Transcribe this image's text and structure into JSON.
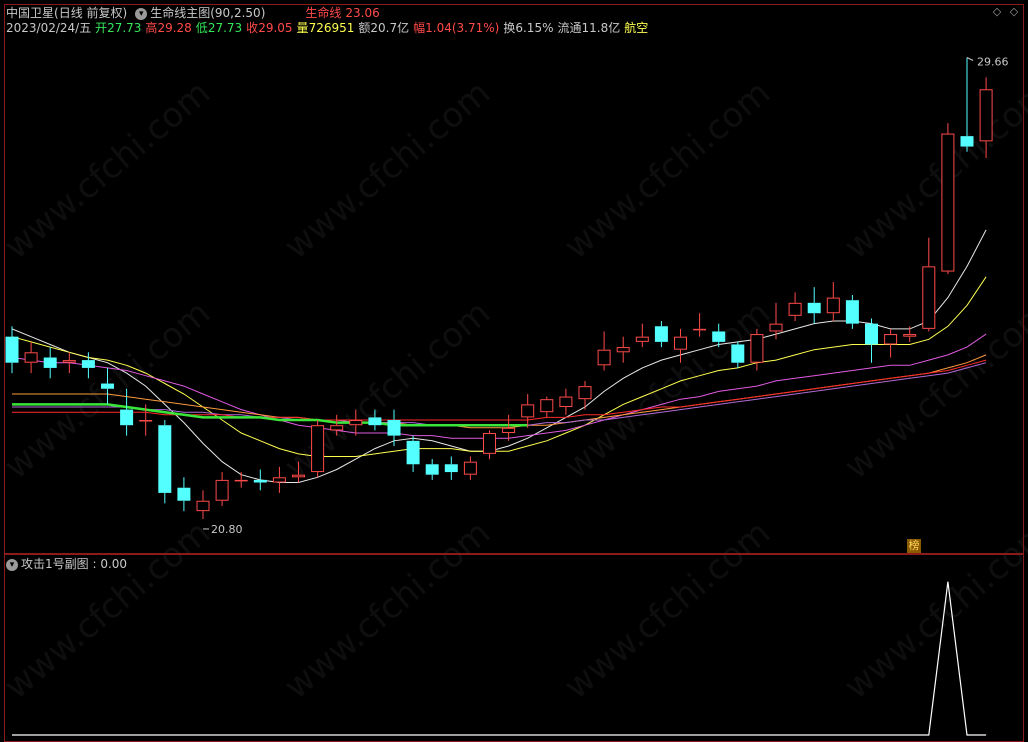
{
  "header": {
    "stock_name": "中国卫星",
    "period_mode": "(日线 前复权)",
    "indicator_name": "生命线主图(90,2.50)",
    "lifeline_label": "生命线",
    "lifeline_value": "23.06"
  },
  "quote": {
    "date": "2023/02/24/五",
    "open_label": "开",
    "open": "27.73",
    "high_label": "高",
    "high": "29.28",
    "low_label": "低",
    "low": "27.73",
    "close_label": "收",
    "close": "29.05",
    "volume_label": "量",
    "volume": "726951",
    "amount_label": "额",
    "amount": "20.7亿",
    "change_label": "幅",
    "change": "1.04(3.71%)",
    "turnover_label": "换",
    "turnover": "6.15%",
    "float_label": "流通",
    "float": "11.8亿",
    "sector": "航空"
  },
  "sub_chart": {
    "title": "攻击1号副图",
    "value": "0.00"
  },
  "badge": "榜",
  "watermark": "www.cfchi.com",
  "colors": {
    "up": "#ff4a4a",
    "down": "#54ffff",
    "lifeline": "#39e639",
    "frame": "#8b1a1a"
  },
  "chart_data": {
    "type": "candlestick",
    "high_label": "29.66",
    "low_label": "20.80",
    "candles": [
      {
        "o": 24.3,
        "c": 23.8,
        "h": 24.5,
        "l": 23.6
      },
      {
        "o": 23.8,
        "c": 24.0,
        "h": 24.2,
        "l": 23.6
      },
      {
        "o": 23.9,
        "c": 23.7,
        "h": 24.1,
        "l": 23.5
      },
      {
        "o": 23.8,
        "c": 23.85,
        "h": 24.0,
        "l": 23.6
      },
      {
        "o": 23.85,
        "c": 23.7,
        "h": 24.0,
        "l": 23.5
      },
      {
        "o": 23.4,
        "c": 23.3,
        "h": 23.7,
        "l": 23.0
      },
      {
        "o": 22.9,
        "c": 22.6,
        "h": 23.3,
        "l": 22.4
      },
      {
        "o": 22.7,
        "c": 22.7,
        "h": 23.0,
        "l": 22.4
      },
      {
        "o": 22.6,
        "c": 21.3,
        "h": 22.7,
        "l": 21.1
      },
      {
        "o": 21.4,
        "c": 21.15,
        "h": 21.6,
        "l": 20.95
      },
      {
        "o": 20.95,
        "c": 21.15,
        "h": 21.35,
        "l": 20.8
      },
      {
        "o": 21.15,
        "c": 21.55,
        "h": 21.7,
        "l": 21.05
      },
      {
        "o": 21.55,
        "c": 21.55,
        "h": 21.7,
        "l": 21.4
      },
      {
        "o": 21.55,
        "c": 21.5,
        "h": 21.75,
        "l": 21.35
      },
      {
        "o": 21.5,
        "c": 21.6,
        "h": 21.8,
        "l": 21.3
      },
      {
        "o": 21.6,
        "c": 21.65,
        "h": 21.9,
        "l": 21.5
      },
      {
        "o": 21.7,
        "c": 22.6,
        "h": 22.7,
        "l": 21.6
      },
      {
        "o": 22.5,
        "c": 22.6,
        "h": 22.8,
        "l": 22.4
      },
      {
        "o": 22.6,
        "c": 22.7,
        "h": 22.9,
        "l": 22.4
      },
      {
        "o": 22.75,
        "c": 22.6,
        "h": 22.9,
        "l": 22.5
      },
      {
        "o": 22.7,
        "c": 22.4,
        "h": 22.9,
        "l": 22.2
      },
      {
        "o": 22.3,
        "c": 21.85,
        "h": 22.4,
        "l": 21.7
      },
      {
        "o": 21.85,
        "c": 21.65,
        "h": 21.95,
        "l": 21.55
      },
      {
        "o": 21.85,
        "c": 21.7,
        "h": 22.0,
        "l": 21.55
      },
      {
        "o": 21.65,
        "c": 21.9,
        "h": 22.0,
        "l": 21.55
      },
      {
        "o": 22.05,
        "c": 22.45,
        "h": 22.5,
        "l": 21.95
      },
      {
        "o": 22.45,
        "c": 22.55,
        "h": 22.8,
        "l": 22.3
      },
      {
        "o": 22.75,
        "c": 23.0,
        "h": 23.2,
        "l": 22.55
      },
      {
        "o": 22.85,
        "c": 23.1,
        "h": 23.15,
        "l": 22.75
      },
      {
        "o": 22.95,
        "c": 23.15,
        "h": 23.3,
        "l": 22.8
      },
      {
        "o": 23.1,
        "c": 23.35,
        "h": 23.45,
        "l": 22.9
      },
      {
        "o": 23.75,
        "c": 24.05,
        "h": 24.4,
        "l": 23.65
      },
      {
        "o": 24.0,
        "c": 24.1,
        "h": 24.3,
        "l": 23.8
      },
      {
        "o": 24.2,
        "c": 24.3,
        "h": 24.55,
        "l": 24.1
      },
      {
        "o": 24.5,
        "c": 24.2,
        "h": 24.6,
        "l": 24.1
      },
      {
        "o": 24.05,
        "c": 24.3,
        "h": 24.45,
        "l": 23.8
      },
      {
        "o": 24.45,
        "c": 24.45,
        "h": 24.75,
        "l": 24.3
      },
      {
        "o": 24.4,
        "c": 24.2,
        "h": 24.55,
        "l": 24.1
      },
      {
        "o": 24.15,
        "c": 23.8,
        "h": 24.2,
        "l": 23.7
      },
      {
        "o": 23.8,
        "c": 24.35,
        "h": 24.45,
        "l": 23.65
      },
      {
        "o": 24.4,
        "c": 24.55,
        "h": 24.95,
        "l": 24.25
      },
      {
        "o": 24.7,
        "c": 24.95,
        "h": 25.15,
        "l": 24.6
      },
      {
        "o": 24.95,
        "c": 24.75,
        "h": 25.25,
        "l": 24.55
      },
      {
        "o": 24.75,
        "c": 25.05,
        "h": 25.35,
        "l": 24.6
      },
      {
        "o": 25.0,
        "c": 24.55,
        "h": 25.1,
        "l": 24.45
      },
      {
        "o": 24.55,
        "c": 24.15,
        "h": 24.65,
        "l": 23.8
      },
      {
        "o": 24.15,
        "c": 24.35,
        "h": 24.45,
        "l": 23.9
      },
      {
        "o": 24.3,
        "c": 24.35,
        "h": 24.5,
        "l": 24.2
      },
      {
        "o": 24.45,
        "c": 25.65,
        "h": 26.2,
        "l": 24.4
      },
      {
        "o": 25.55,
        "c": 28.2,
        "h": 28.4,
        "l": 25.5
      },
      {
        "o": 28.15,
        "c": 27.95,
        "h": 29.66,
        "l": 27.85
      },
      {
        "o": 28.05,
        "c": 29.05,
        "h": 29.28,
        "l": 27.73
      }
    ],
    "mas": [
      {
        "name": "ma-white",
        "color": "#e8e8e8",
        "values": [
          24.45,
          24.3,
          24.15,
          24.0,
          23.9,
          23.8,
          23.6,
          23.35,
          23.0,
          22.65,
          22.25,
          21.9,
          21.65,
          21.55,
          21.5,
          21.5,
          21.6,
          21.75,
          21.95,
          22.15,
          22.3,
          22.35,
          22.3,
          22.2,
          22.1,
          22.1,
          22.2,
          22.35,
          22.55,
          22.75,
          22.95,
          23.25,
          23.5,
          23.7,
          23.85,
          23.95,
          24.05,
          24.15,
          24.2,
          24.25,
          24.35,
          24.45,
          24.55,
          24.6,
          24.6,
          24.55,
          24.45,
          24.45,
          24.6,
          25.05,
          25.65,
          26.35
        ]
      },
      {
        "name": "ma-yellow",
        "color": "#ffff50",
        "values": [
          24.3,
          24.2,
          24.1,
          24.0,
          23.9,
          23.85,
          23.75,
          23.6,
          23.4,
          23.2,
          22.95,
          22.7,
          22.45,
          22.3,
          22.15,
          22.05,
          22.0,
          22.0,
          22.0,
          22.05,
          22.1,
          22.15,
          22.15,
          22.15,
          22.1,
          22.1,
          22.1,
          22.2,
          22.3,
          22.45,
          22.6,
          22.8,
          23.0,
          23.15,
          23.3,
          23.45,
          23.55,
          23.65,
          23.7,
          23.8,
          23.85,
          23.95,
          24.05,
          24.1,
          24.15,
          24.15,
          24.15,
          24.15,
          24.25,
          24.5,
          24.9,
          25.45
        ]
      },
      {
        "name": "ma-magenta",
        "color": "#e05ae0",
        "values": [
          23.9,
          23.85,
          23.8,
          23.8,
          23.75,
          23.7,
          23.65,
          23.55,
          23.45,
          23.35,
          23.2,
          23.05,
          22.9,
          22.8,
          22.7,
          22.6,
          22.55,
          22.5,
          22.45,
          22.45,
          22.45,
          22.4,
          22.4,
          22.35,
          22.35,
          22.35,
          22.35,
          22.4,
          22.45,
          22.5,
          22.6,
          22.7,
          22.8,
          22.9,
          23.0,
          23.1,
          23.15,
          23.25,
          23.3,
          23.35,
          23.45,
          23.5,
          23.55,
          23.6,
          23.65,
          23.7,
          23.75,
          23.75,
          23.85,
          23.95,
          24.1,
          24.35
        ]
      },
      {
        "name": "ma-orange",
        "color": "#ff9a3c",
        "values": [
          23.2,
          23.2,
          23.2,
          23.2,
          23.2,
          23.2,
          23.15,
          23.1,
          23.05,
          23.0,
          22.95,
          22.9,
          22.85,
          22.8,
          22.75,
          22.75,
          22.7,
          22.7,
          22.65,
          22.65,
          22.65,
          22.6,
          22.6,
          22.6,
          22.55,
          22.55,
          22.55,
          22.6,
          22.6,
          22.65,
          22.7,
          22.75,
          22.8,
          22.85,
          22.9,
          22.95,
          23.0,
          23.05,
          23.1,
          23.15,
          23.2,
          23.25,
          23.3,
          23.35,
          23.4,
          23.45,
          23.5,
          23.55,
          23.6,
          23.7,
          23.8,
          23.95
        ]
      },
      {
        "name": "ma-purple",
        "color": "#b06ad6",
        "values": [
          22.95,
          22.95,
          22.95,
          22.95,
          22.95,
          22.95,
          22.95,
          22.9,
          22.9,
          22.85,
          22.85,
          22.8,
          22.8,
          22.75,
          22.75,
          22.7,
          22.7,
          22.7,
          22.65,
          22.65,
          22.65,
          22.65,
          22.6,
          22.6,
          22.6,
          22.6,
          22.6,
          22.6,
          22.65,
          22.65,
          22.7,
          22.7,
          22.75,
          22.8,
          22.85,
          22.9,
          22.95,
          23.0,
          23.05,
          23.1,
          23.15,
          23.2,
          23.25,
          23.3,
          23.35,
          23.4,
          23.45,
          23.5,
          23.55,
          23.6,
          23.7,
          23.8
        ]
      },
      {
        "name": "ma-red",
        "color": "#ff2a2a",
        "values": [
          22.85,
          22.85,
          22.85,
          22.85,
          22.85,
          22.85,
          22.85,
          22.85,
          22.8,
          22.8,
          22.8,
          22.8,
          22.75,
          22.75,
          22.75,
          22.75,
          22.7,
          22.7,
          22.7,
          22.7,
          22.7,
          22.7,
          22.7,
          22.7,
          22.7,
          22.7,
          22.7,
          22.7,
          22.75,
          22.75,
          22.8,
          22.8,
          22.85,
          22.9,
          22.95,
          22.95,
          23.0,
          23.05,
          23.1,
          23.15,
          23.2,
          23.25,
          23.3,
          23.35,
          23.4,
          23.45,
          23.5,
          23.55,
          23.6,
          23.65,
          23.75,
          23.85
        ]
      }
    ],
    "lifeline": [
      23.0,
      23.0,
      23.0,
      23.0,
      23.0,
      23.0,
      22.95,
      22.9,
      22.85,
      22.8,
      22.75,
      22.75,
      22.75,
      22.75,
      22.7,
      22.7,
      22.7,
      22.65,
      22.65,
      22.65,
      22.6,
      22.6,
      22.6,
      22.6,
      22.6,
      22.6,
      22.6,
      22.6
    ],
    "ylim": [
      20.3,
      29.9
    ],
    "sub": {
      "values": [
        0,
        0,
        0,
        0,
        0,
        0,
        0,
        0,
        0,
        0,
        0,
        0,
        0,
        0,
        0,
        0,
        0,
        0,
        0,
        0,
        0,
        0,
        0,
        0,
        0,
        0,
        0,
        0,
        0,
        0,
        0,
        0,
        0,
        0,
        0,
        0,
        0,
        0,
        0,
        0,
        0,
        0,
        0,
        0,
        0,
        0,
        0,
        0,
        0,
        1,
        0,
        0
      ],
      "ylim": [
        0,
        1.05
      ]
    }
  }
}
